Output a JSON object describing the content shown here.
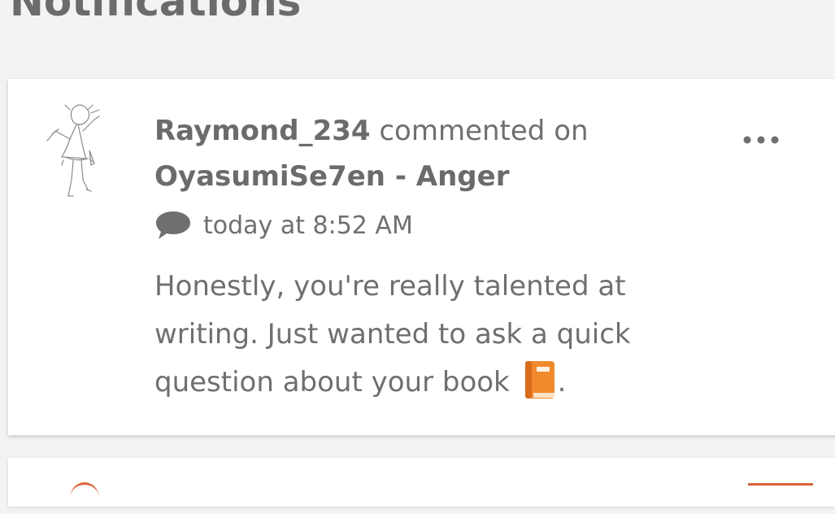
{
  "page": {
    "heading": "Notifications"
  },
  "notification": {
    "username": "Raymond_234",
    "action": "commented on",
    "story_title": "OyasumiSe7en - Anger",
    "timestamp": "today at 8:52 AM",
    "message_text": "Honestly, you're really talented at writing. Just wanted to ask a quick question about your book",
    "message_suffix": ".",
    "avatar_icon": "avatar-sketch-figure",
    "comment_icon": "speech-bubble-icon",
    "more_icon": "more-dots-icon",
    "emoji": "orange-book-emoji"
  },
  "colors": {
    "background": "#f3f3f3",
    "card": "#ffffff",
    "text": "#6f6f6f",
    "accent": "#d8643a",
    "book_orange": "#f08a2c"
  }
}
